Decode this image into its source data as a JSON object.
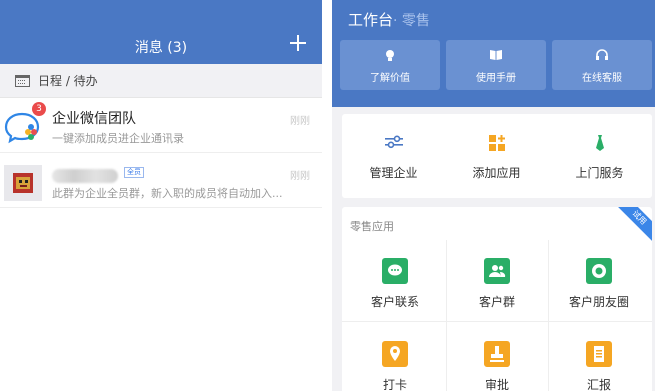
{
  "messages_pane": {
    "title": "消息 (3)",
    "schedule_label": "日程 / 待办",
    "items": [
      {
        "title": "企业微信团队",
        "subtitle": "一键添加成员进企业通讯录",
        "time": "刚刚",
        "badge": "3"
      },
      {
        "tag": "全员",
        "subtitle": "此群为企业全员群，新入职的成员将自动加入...",
        "time": "刚刚"
      }
    ]
  },
  "workbench": {
    "title": "工作台",
    "subtitle": "· 零售",
    "top_buttons": [
      {
        "label": "了解价值",
        "icon": "lightbulb-icon"
      },
      {
        "label": "使用手册",
        "icon": "book-icon"
      },
      {
        "label": "在线客服",
        "icon": "headset-icon"
      }
    ],
    "tools": [
      {
        "label": "管理企业",
        "icon": "sliders-icon",
        "color": "#4a78c4"
      },
      {
        "label": "添加应用",
        "icon": "add-app-icon",
        "color": "#f5a623"
      },
      {
        "label": "上门服务",
        "icon": "tie-icon",
        "color": "#2aae67"
      }
    ],
    "retail_section_label": "零售应用",
    "trial_badge": "试用",
    "apps": [
      {
        "label": "客户联系",
        "icon": "chat-icon",
        "color": "#2aae67"
      },
      {
        "label": "客户群",
        "icon": "group-icon",
        "color": "#2aae67"
      },
      {
        "label": "客户朋友圈",
        "icon": "moments-icon",
        "color": "#2aae67"
      },
      {
        "label": "打卡",
        "icon": "location-icon",
        "color": "#f5a623"
      },
      {
        "label": "审批",
        "icon": "stamp-icon",
        "color": "#f5a623"
      },
      {
        "label": "汇报",
        "icon": "report-icon",
        "color": "#f5a623"
      }
    ]
  }
}
